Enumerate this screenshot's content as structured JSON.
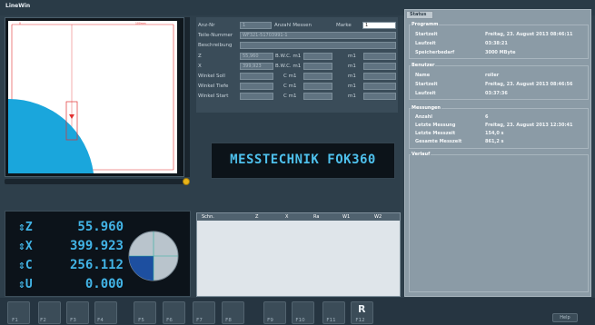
{
  "app": {
    "title": "LineWin"
  },
  "plot": {
    "top_label": "0",
    "top_right_label": "100mm"
  },
  "axes": [
    {
      "icon": "⇕Z",
      "value": "55.960"
    },
    {
      "icon": "⇕X",
      "value": "399.923"
    },
    {
      "icon": "⇕C",
      "value": "256.112"
    },
    {
      "icon": "⇕U",
      "value": "0.000"
    }
  ],
  "form": {
    "rows": [
      {
        "label": "Anz-Nr",
        "value": "1",
        "mid_label": "Anzahl Messen",
        "right_label": "Marke",
        "right_value": "1"
      },
      {
        "label": "Teile-Nummer",
        "value": "WF321-51703991-1"
      },
      {
        "label": "Beschreibung",
        "value": ""
      },
      {
        "label": "Z",
        "value": "55,960",
        "sub_label": "B.W.C.  m1",
        "sub2_label": "m1"
      },
      {
        "label": "X",
        "value": "399,923",
        "sub_label": "B.W.C.  m1",
        "sub2_label": "m1"
      },
      {
        "label": "Winkel Soll",
        "value": "",
        "sub_label": "C  m1",
        "sub2_label": "m1"
      },
      {
        "label": "Winkel Tiefe",
        "value": "",
        "sub_label": "C  m1",
        "sub2_label": "m1"
      },
      {
        "label": "Winkel Start",
        "value": "",
        "sub_label": "C  m1",
        "sub2_label": "m1"
      }
    ]
  },
  "brand": {
    "text": "MESSTECHNIK FOK360"
  },
  "table": {
    "headers": [
      "Schn.",
      "Z",
      "X",
      "Ra",
      "W1",
      "W2"
    ]
  },
  "status": {
    "tab": "Status",
    "groups": [
      {
        "title": "Programm",
        "rows": [
          {
            "label": "Startzeit",
            "value": "Freitag, 23. August 2013 08:46:11"
          },
          {
            "label": "Laufzeit",
            "value": "03:38:21"
          },
          {
            "label": "Speicherbedarf",
            "value": "3000 MByte"
          }
        ]
      },
      {
        "title": "Benutzer",
        "rows": [
          {
            "label": "Name",
            "value": "roller"
          },
          {
            "label": "Startzeit",
            "value": "Freitag, 23. August 2013 08:46:56"
          },
          {
            "label": "Laufzeit",
            "value": "03:37:36"
          }
        ]
      },
      {
        "title": "Messungen",
        "rows": [
          {
            "label": "Anzahl",
            "value": "6"
          },
          {
            "label": "Letzte Messung",
            "value": "Freitag, 23. August 2013 12:30:41"
          },
          {
            "label": "Letzte Messzeit",
            "value": "154,0 s"
          },
          {
            "label": "Gesamte Messzeit",
            "value": "861,2 s"
          }
        ]
      },
      {
        "title": "Verlauf",
        "rows": []
      }
    ]
  },
  "fkeys": [
    "F1",
    "F2",
    "F3",
    "F4",
    "F5",
    "F6",
    "F7",
    "F8",
    "F9",
    "F10",
    "F11",
    "F12"
  ],
  "help": "Help",
  "colors": {
    "accent": "#42b4e6",
    "plot_fill": "#1aa6dc",
    "plot_line": "#e23030"
  }
}
